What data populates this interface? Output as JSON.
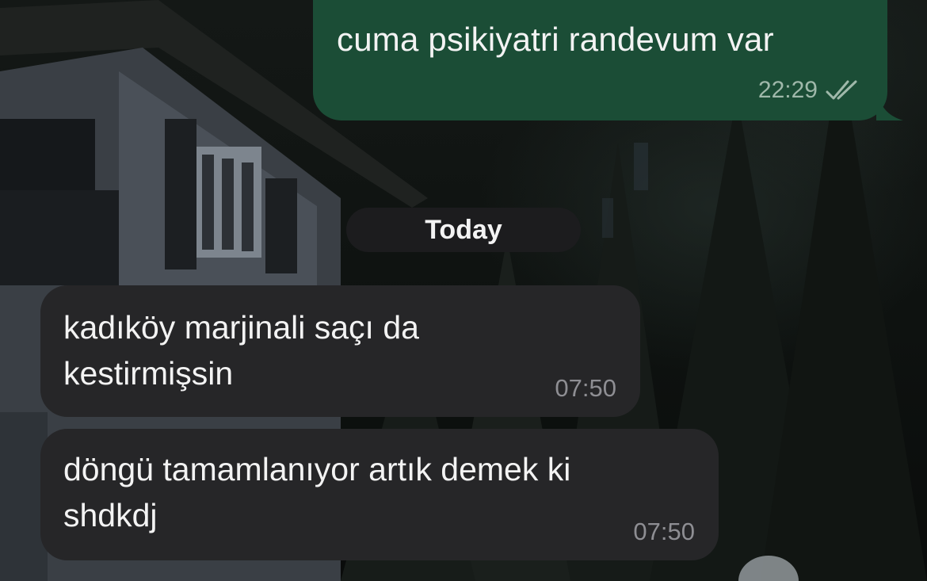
{
  "colors": {
    "outgoing_bubble": "#1b4d36",
    "incoming_bubble": "#262628",
    "date_pill": "#1c1c1e",
    "text": "#f3f3f3",
    "timestamp_outgoing": "#9fb8aa",
    "timestamp_incoming": "#8e8e93"
  },
  "messages": [
    {
      "direction": "outgoing",
      "text": "cuma psikiyatri randevum var",
      "time": "22:29",
      "status_icon": "double-check-icon"
    }
  ],
  "date_separator": "Today",
  "incoming": [
    {
      "text": "kadıköy marjinali saçı da\nkestirmişsin",
      "time": "07:50"
    },
    {
      "text": "döngü tamamlanıyor artık demek ki\nshdkdj",
      "time": "07:50"
    }
  ]
}
